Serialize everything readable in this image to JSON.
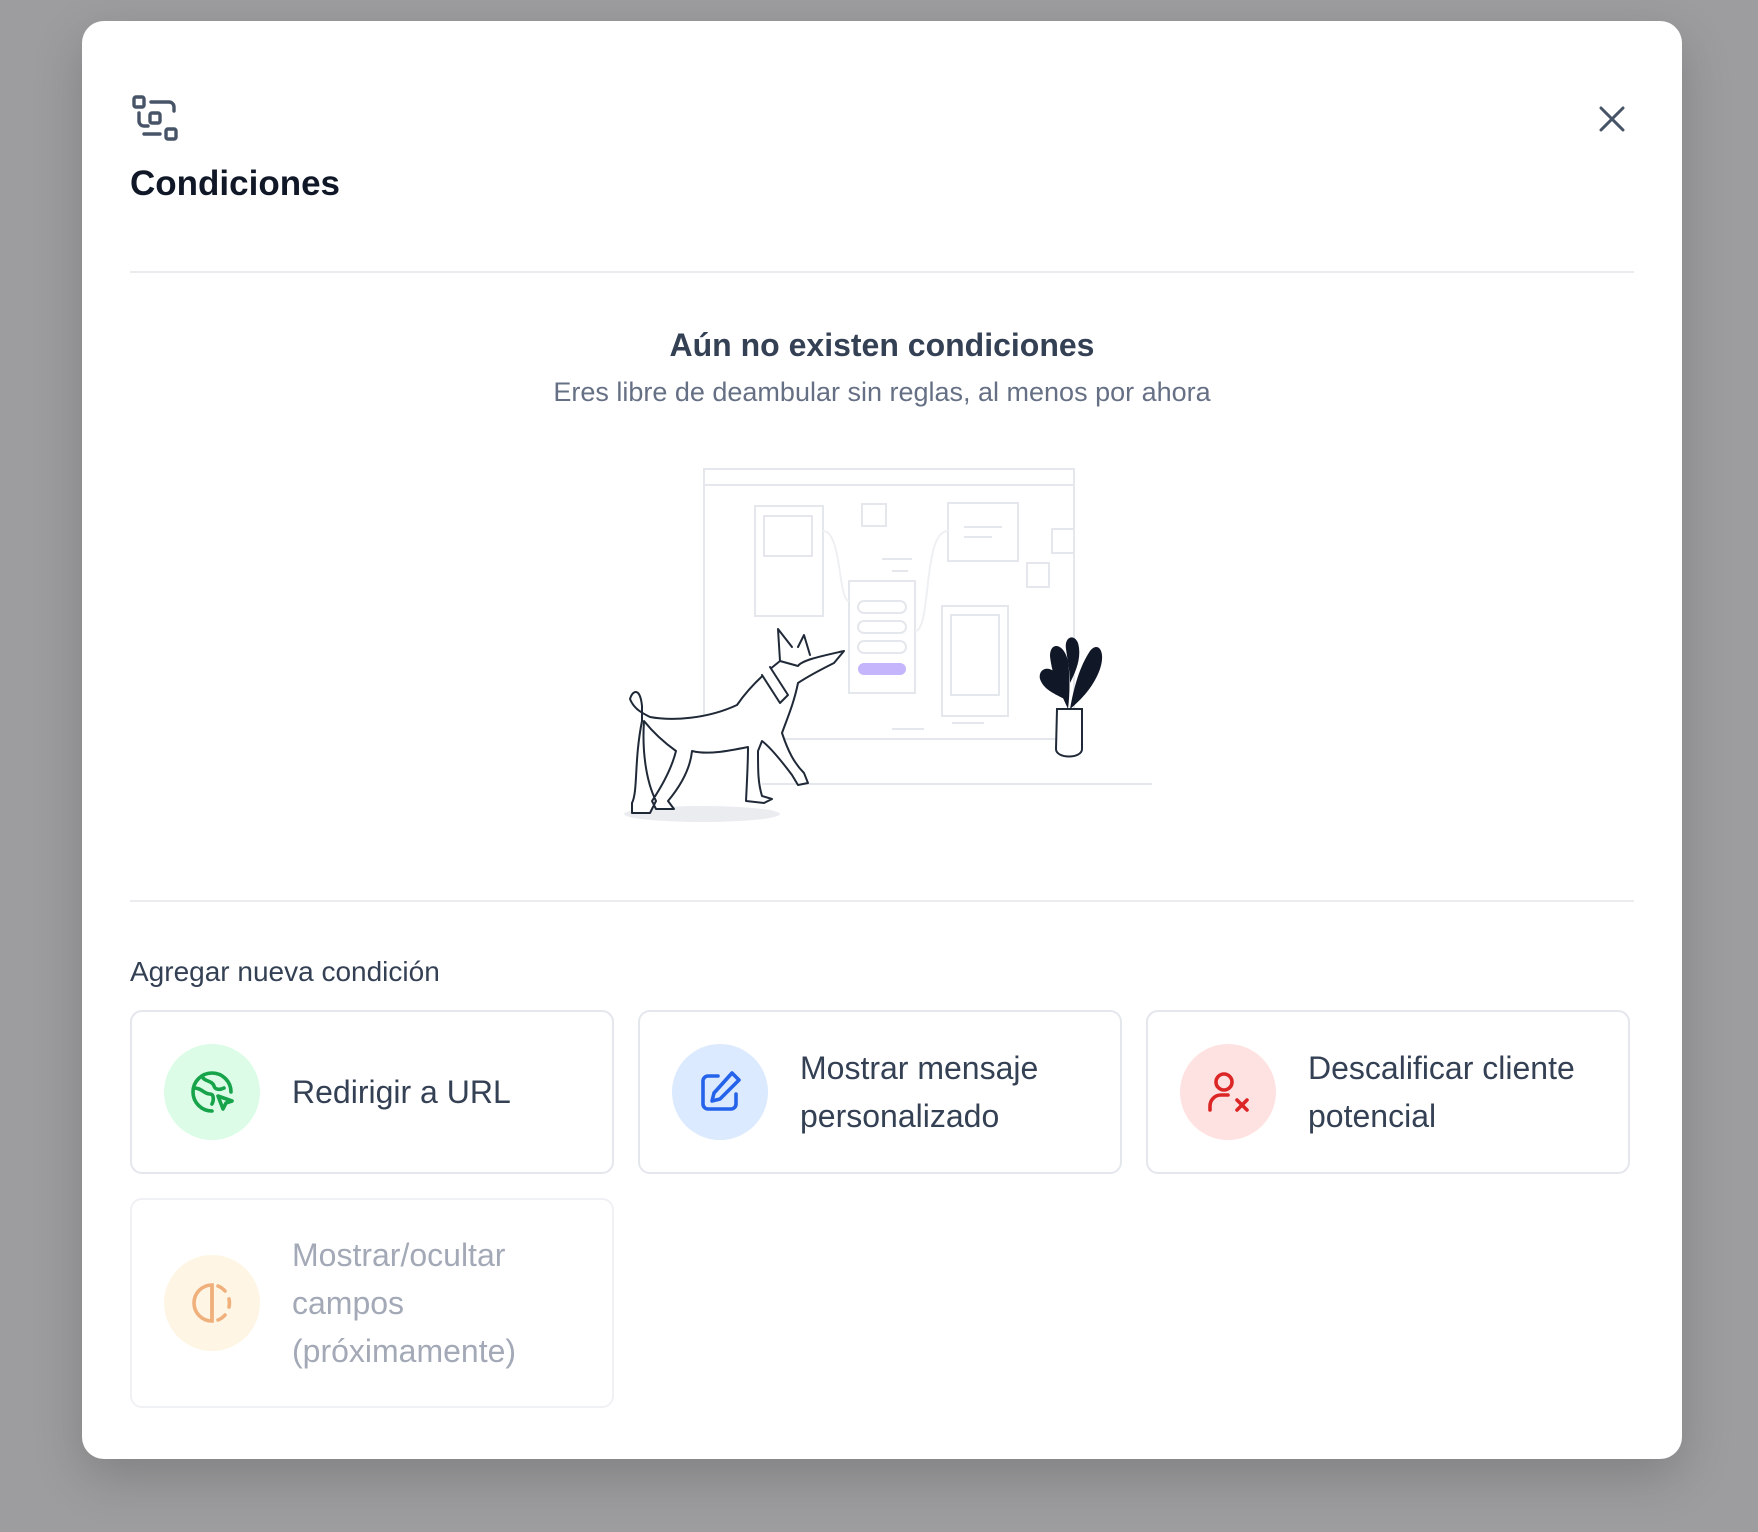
{
  "modal": {
    "title": "Condiciones",
    "header_icon": "conditions-icon",
    "close_icon": "close-icon"
  },
  "empty_state": {
    "title": "Aún no existen condiciones",
    "subtitle": "Eres libre de deambular sin reglas, al menos por ahora",
    "illustration": "dog-and-plant-illustration"
  },
  "add_section": {
    "label": "Agregar nueva condición",
    "options": [
      {
        "label": "Redirigir a URL",
        "icon": "globe-cursor-icon",
        "icon_color": "#16a34a",
        "bg_color": "#dcfce7",
        "enabled": true
      },
      {
        "label": "Mostrar mensaje personalizado",
        "icon": "edit-message-icon",
        "icon_color": "#2563eb",
        "bg_color": "#dbeafe",
        "enabled": true
      },
      {
        "label": "Descalificar cliente potencial",
        "icon": "user-x-icon",
        "icon_color": "#dc2626",
        "bg_color": "#fee2e2",
        "enabled": true
      },
      {
        "label": "Mostrar/ocultar campos (próximamente)",
        "icon": "half-circle-icon",
        "icon_color": "#f0b07c",
        "bg_color": "#fef5e4",
        "enabled": false
      }
    ]
  }
}
